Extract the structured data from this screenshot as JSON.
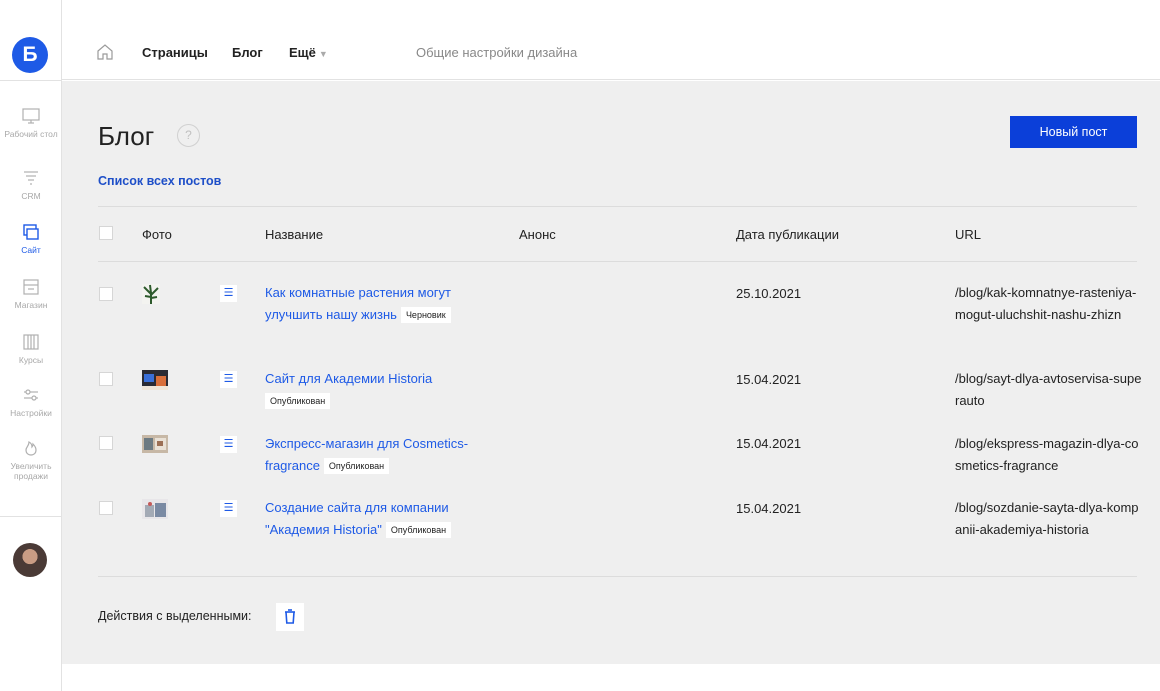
{
  "logo": {
    "letter": "Б"
  },
  "sidebar": {
    "items": [
      {
        "label": "Рабочий стол",
        "icon": "monitor-icon"
      },
      {
        "label": "CRM",
        "icon": "funnel-icon"
      },
      {
        "label": "Сайт",
        "icon": "pages-icon",
        "active": true
      },
      {
        "label": "Магазин",
        "icon": "store-icon"
      },
      {
        "label": "Курсы",
        "icon": "books-icon"
      },
      {
        "label": "Настройки",
        "icon": "sliders-icon"
      },
      {
        "label": "Увеличить продажи",
        "icon": "flame-icon"
      }
    ]
  },
  "topbar": {
    "nav": [
      "Страницы",
      "Блог",
      "Ещё"
    ],
    "design_settings": "Общие настройки дизайна"
  },
  "page": {
    "title": "Блог",
    "help": "?",
    "new_post": "Новый пост",
    "list_link": "Список всех постов"
  },
  "table": {
    "headers": {
      "photo": "Фото",
      "name": "Название",
      "announce": "Анонс",
      "date": "Дата публикации",
      "url": "URL"
    },
    "rows": [
      {
        "title": "Как комнатные растения могут улучшить нашу жизнь",
        "status": "Черновик",
        "date": "25.10.2021",
        "url": "/blog/kak-komnatnye-rasteniya-mogut-uluchshit-nashu-zhizn"
      },
      {
        "title": "Сайт для Академии Historia",
        "status": "Опубликован",
        "date": "15.04.2021",
        "url": "/blog/sayt-dlya-avtoservisa-superauto"
      },
      {
        "title": "Экспресс-магазин для Cosmetics-fragrance",
        "status": "Опубликован",
        "date": "15.04.2021",
        "url": "/blog/ekspress-magazin-dlya-cosmetics-fragrance"
      },
      {
        "title": "Создание сайта для компании \"Академия Historia\"",
        "status": "Опубликован",
        "date": "15.04.2021",
        "url": "/blog/sozdanie-sayta-dlya-kompanii-akademiya-historia"
      }
    ]
  },
  "bulk": {
    "label": "Действия с выделенными:"
  },
  "colors": {
    "accent": "#1e5ae6",
    "button": "#0b3fd9",
    "background": "#efefef"
  }
}
